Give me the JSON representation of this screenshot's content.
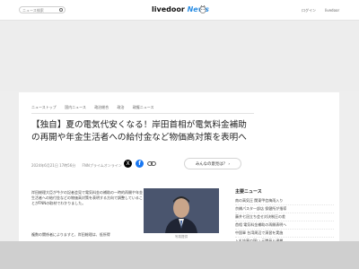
{
  "header": {
    "search_placeholder": "ニュース検索",
    "logo_brand": "livedoor",
    "logo_news": "News",
    "login_label": "ログイン",
    "register_label": "livedoor"
  },
  "breadcrumbs": [
    "ニューストップ",
    "国内ニュース",
    "政治総合",
    "政治",
    "政権ニュース"
  ],
  "article": {
    "headline": "【独自】夏の電気代安くなる！岸田首相が電気料金補助の再開や年金生活者への給付金など物価高対策を表明へ",
    "date": "2024年6月21日 17時56分",
    "source": "FNNプライムオンライン",
    "opinion_button": "みんなの意見は？",
    "body_paragraph_1": "岸田総理大臣が今夕の記者会見で電気料金の補助の一時的再開や年金生活者への給付金などの物価高対策を表明する方向で調整していることがFNNの取材でわかりました。",
    "body_paragraph_2": "複数の関係者によりますと、岸田総理は、低所得",
    "photo_caption": "写真提供"
  },
  "share": {
    "x_label": "X",
    "fb_label": "f"
  },
  "sidebar": {
    "title": "主要ニュース",
    "items": [
      "南の高気圧 関東甲信梅雨入り",
      "京橋パスタ一部店 保健所が指導",
      "藤井七冠立ち会せ対決制圧の差",
      "首相 電気料金補助の再開表明へ",
      "中国軍 台湾周辺で演習を実施",
      "入札妨害の疑い 元職員ら逮捕"
    ]
  }
}
